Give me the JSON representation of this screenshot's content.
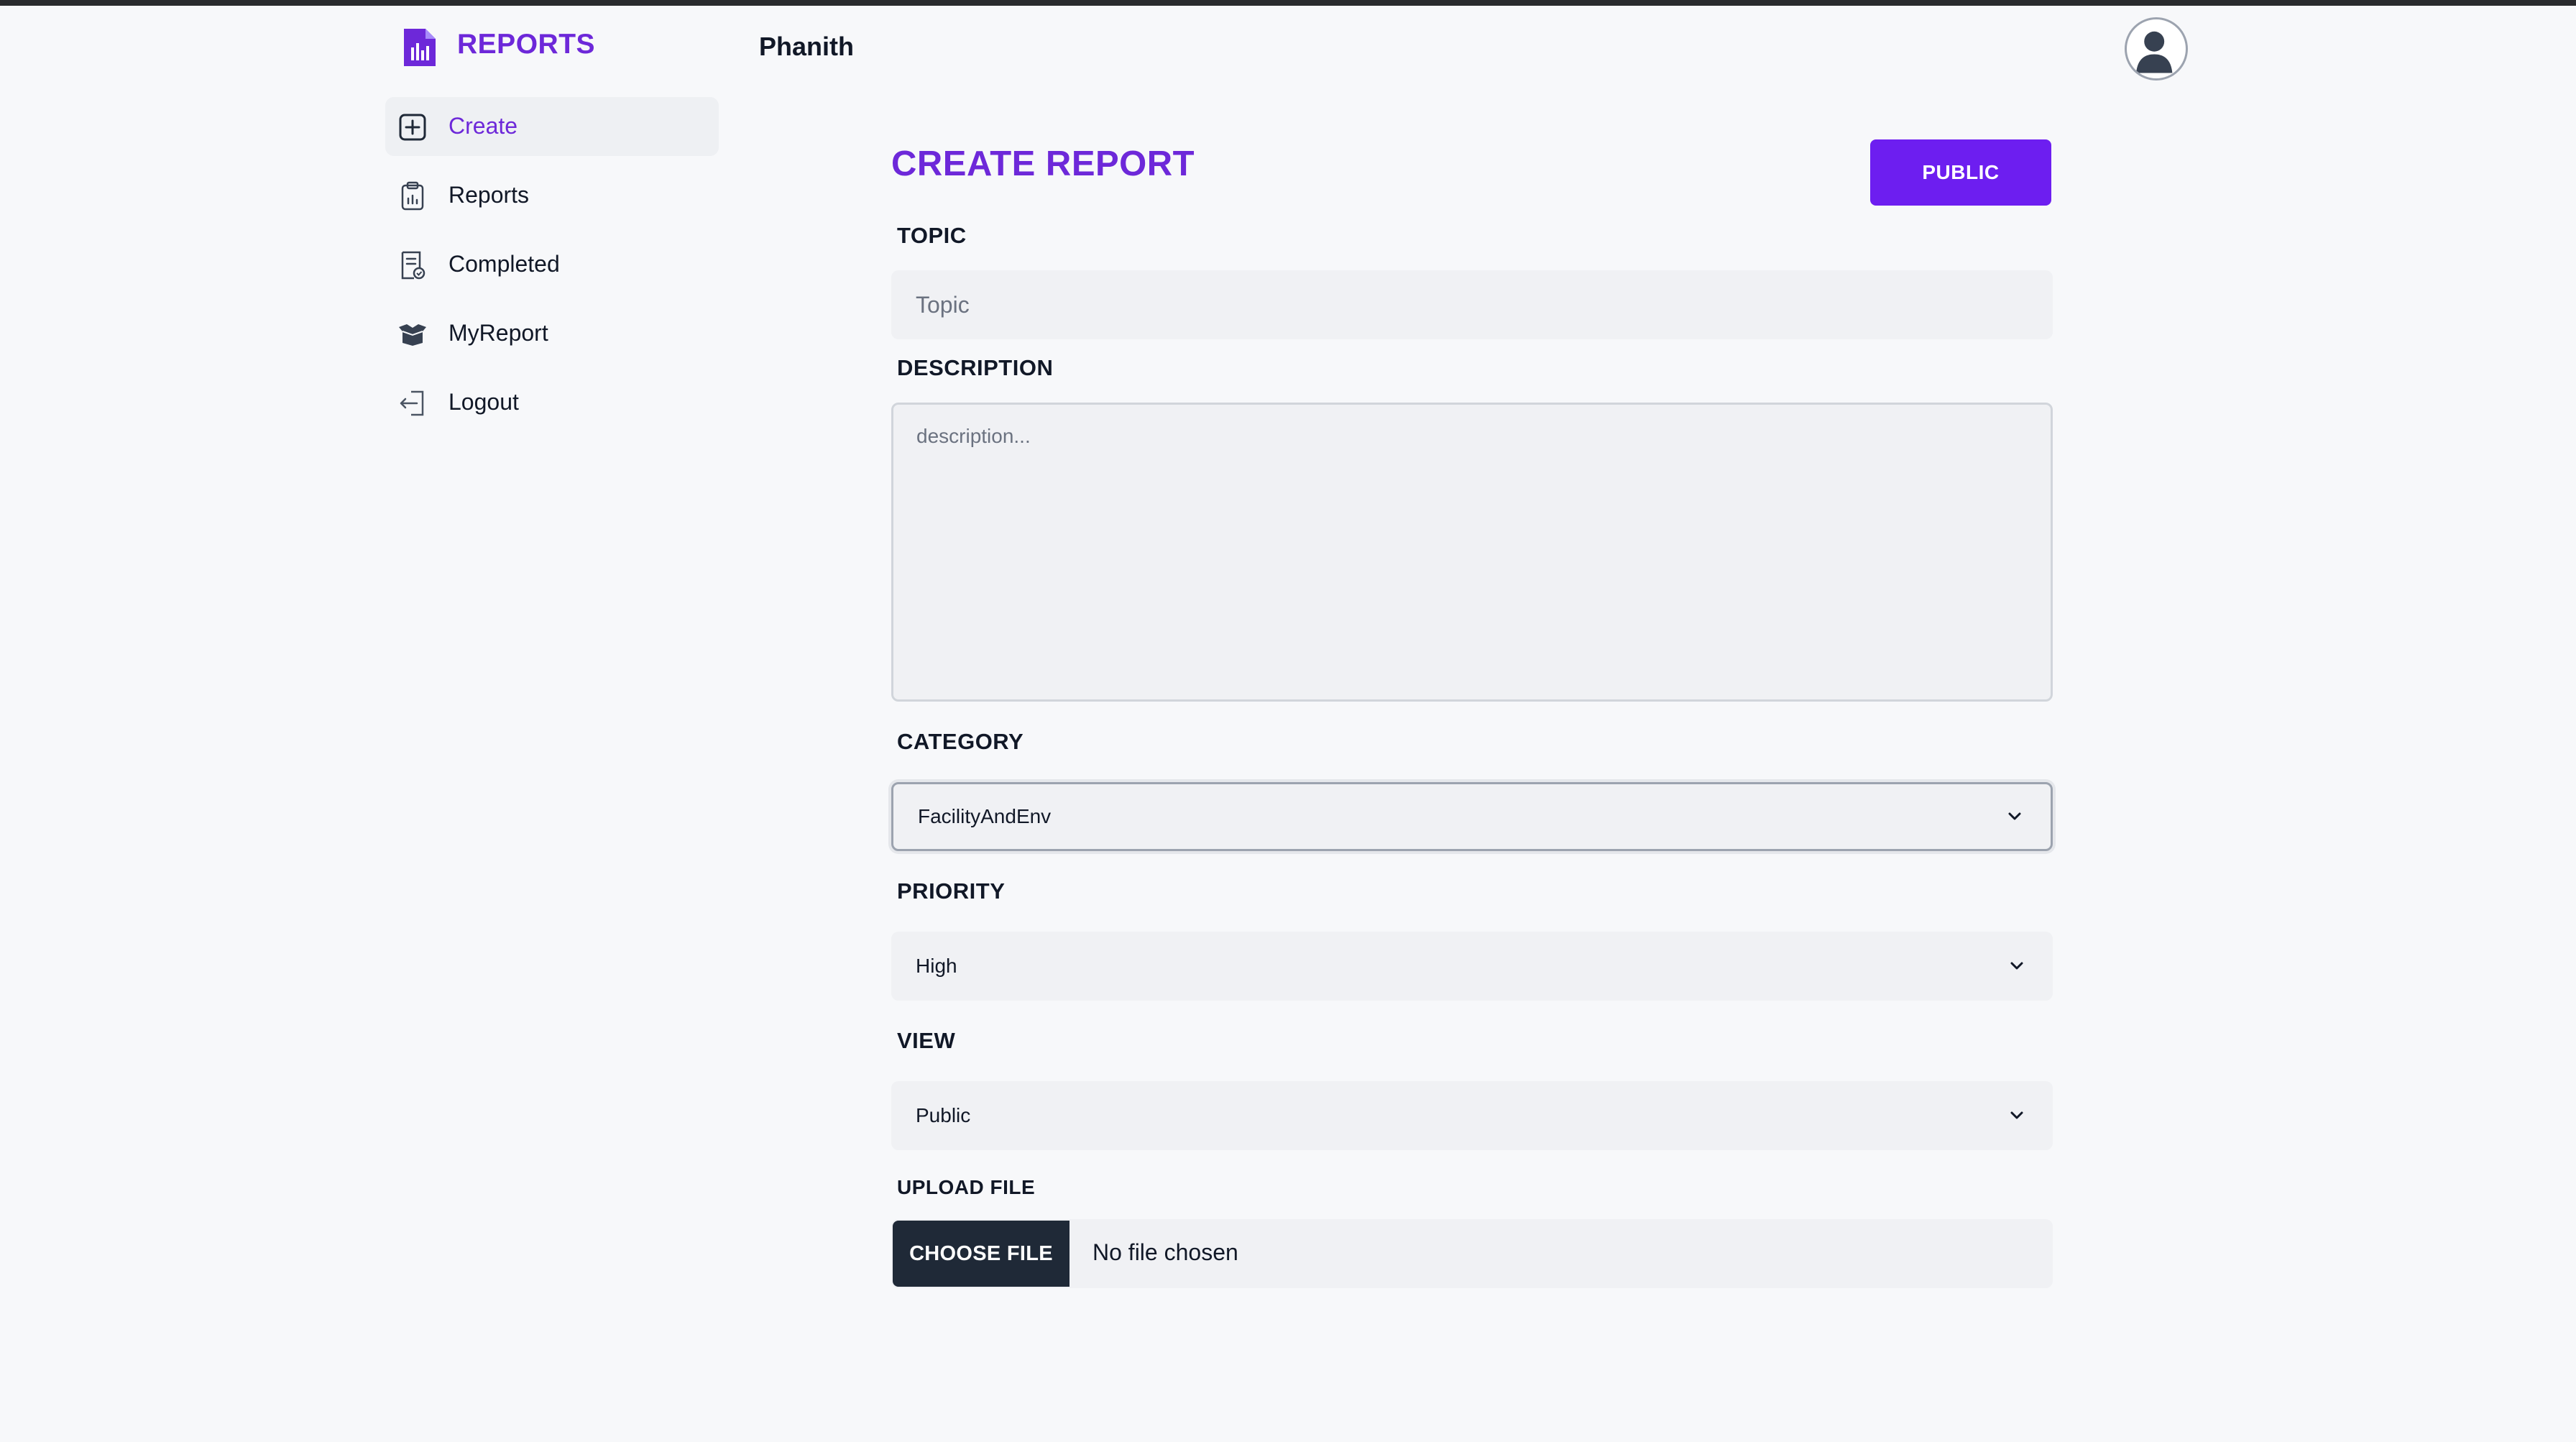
{
  "app": {
    "brand": "REPORTS",
    "username": "Phanith",
    "accent_color": "#6d28d9",
    "button_color": "#6d1ef0"
  },
  "sidebar": {
    "items": [
      {
        "label": "Create",
        "icon": "plus-square-icon",
        "active": true
      },
      {
        "label": "Reports",
        "icon": "clipboard-chart-icon",
        "active": false
      },
      {
        "label": "Completed",
        "icon": "document-check-icon",
        "active": false
      },
      {
        "label": "MyReport",
        "icon": "open-box-icon",
        "active": false
      },
      {
        "label": "Logout",
        "icon": "logout-icon",
        "active": false
      }
    ]
  },
  "main": {
    "title": "CREATE REPORT",
    "public_button": "PUBLIC",
    "topic": {
      "label": "TOPIC",
      "value": "",
      "placeholder": "Topic"
    },
    "description": {
      "label": "DESCRIPTION",
      "value": "",
      "placeholder": "description..."
    },
    "category": {
      "label": "CATEGORY",
      "value": "FacilityAndEnv"
    },
    "priority": {
      "label": "PRIORITY",
      "value": "High"
    },
    "view": {
      "label": "VIEW",
      "value": "Public"
    },
    "upload": {
      "label": "UPLOAD FILE",
      "button": "CHOOSE FILE",
      "status": "No file chosen"
    }
  }
}
